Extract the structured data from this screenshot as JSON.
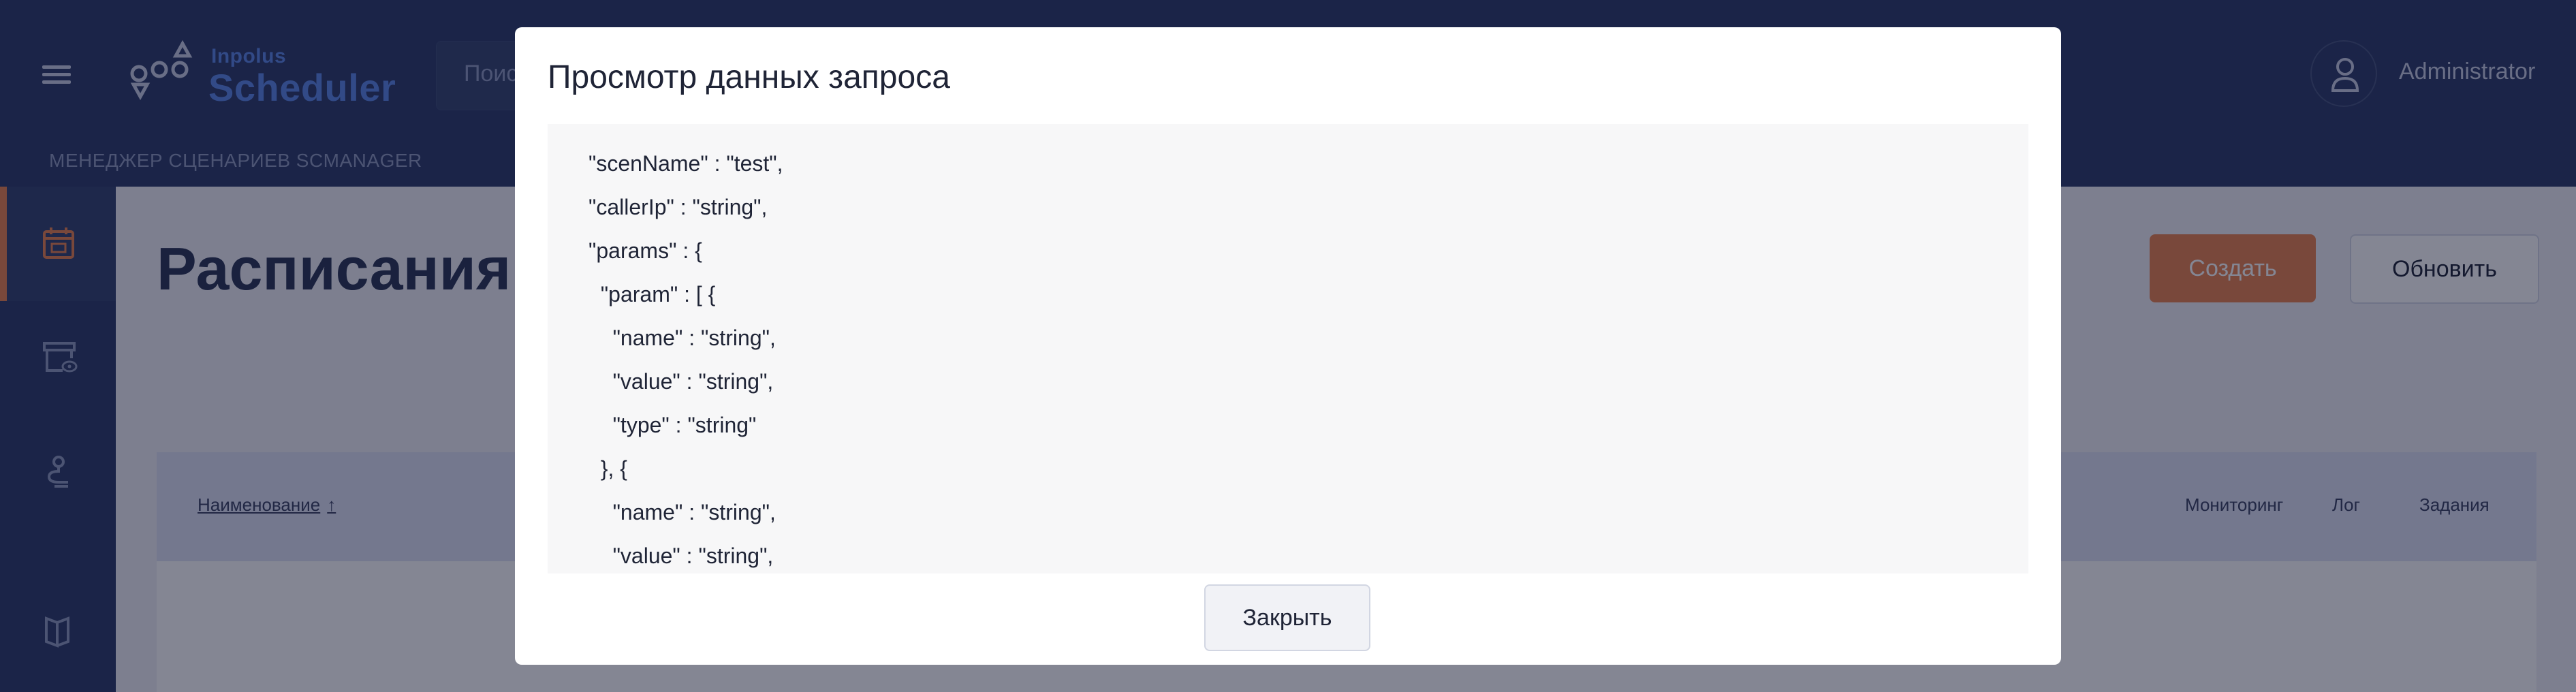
{
  "app": {
    "logo_small": "Inpolus",
    "logo_big": "Scheduler",
    "module_title": "МЕНЕДЖЕР СЦЕНАРИЕВ SCMANAGER",
    "user_name": "Administrator",
    "accent_color": "#e8834f",
    "header_color": "#2c3b68"
  },
  "search": {
    "placeholder": "Поиск"
  },
  "sidebar": {
    "items": [
      {
        "icon": "calendar-icon",
        "active": true
      },
      {
        "icon": "archive-view-icon",
        "active": false
      },
      {
        "icon": "scenario-icon",
        "active": false
      },
      {
        "icon": "book-icon",
        "active": false
      }
    ]
  },
  "page": {
    "title": "Расписания",
    "create_label": "Создать",
    "refresh_label": "Обновить"
  },
  "table": {
    "columns": {
      "name": "Наименование",
      "monitoring": "Мониторинг",
      "log": "Лог",
      "tasks": "Задания"
    }
  },
  "modal": {
    "title": "Просмотр данных запроса",
    "close_label": "Закрыть",
    "code_lines": [
      "\"scenName\" : \"test\",",
      "\"callerIp\" : \"string\",",
      "\"params\" : {",
      "  \"param\" : [ {",
      "    \"name\" : \"string\",",
      "    \"value\" : \"string\",",
      "    \"type\" : \"string\"",
      "  }, {",
      "    \"name\" : \"string\",",
      "    \"value\" : \"string\","
    ]
  }
}
